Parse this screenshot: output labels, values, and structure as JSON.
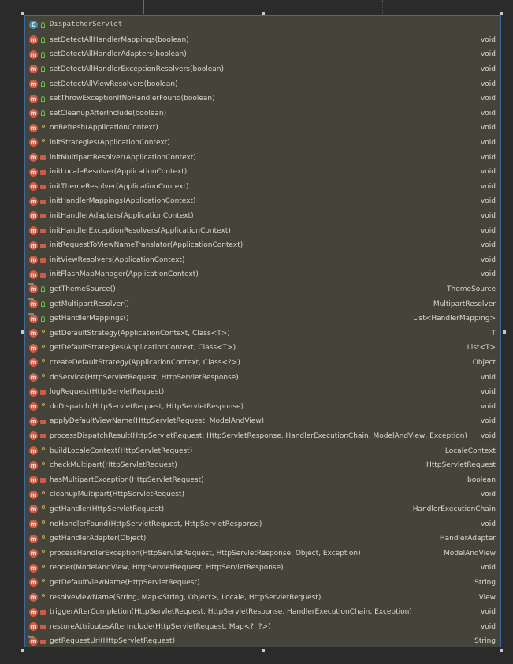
{
  "class_name": "DispatcherServlet",
  "methods": [
    {
      "name": "setDetectAllHandlerMappings(boolean)",
      "ret": "void",
      "vis": "public",
      "override": false
    },
    {
      "name": "setDetectAllHandlerAdapters(boolean)",
      "ret": "void",
      "vis": "public",
      "override": false
    },
    {
      "name": "setDetectAllHandlerExceptionResolvers(boolean)",
      "ret": "void",
      "vis": "public",
      "override": false
    },
    {
      "name": "setDetectAllViewResolvers(boolean)",
      "ret": "void",
      "vis": "public",
      "override": false
    },
    {
      "name": "setThrowExceptionIfNoHandlerFound(boolean)",
      "ret": "void",
      "vis": "public",
      "override": false
    },
    {
      "name": "setCleanupAfterInclude(boolean)",
      "ret": "void",
      "vis": "public",
      "override": false
    },
    {
      "name": "onRefresh(ApplicationContext)",
      "ret": "void",
      "vis": "protected",
      "override": false
    },
    {
      "name": "initStrategies(ApplicationContext)",
      "ret": "void",
      "vis": "protected",
      "override": false
    },
    {
      "name": "initMultipartResolver(ApplicationContext)",
      "ret": "void",
      "vis": "private",
      "override": false
    },
    {
      "name": "initLocaleResolver(ApplicationContext)",
      "ret": "void",
      "vis": "private",
      "override": false
    },
    {
      "name": "initThemeResolver(ApplicationContext)",
      "ret": "void",
      "vis": "private",
      "override": false
    },
    {
      "name": "initHandlerMappings(ApplicationContext)",
      "ret": "void",
      "vis": "private",
      "override": false
    },
    {
      "name": "initHandlerAdapters(ApplicationContext)",
      "ret": "void",
      "vis": "private",
      "override": false
    },
    {
      "name": "initHandlerExceptionResolvers(ApplicationContext)",
      "ret": "void",
      "vis": "private",
      "override": false
    },
    {
      "name": "initRequestToViewNameTranslator(ApplicationContext)",
      "ret": "void",
      "vis": "private",
      "override": false
    },
    {
      "name": "initViewResolvers(ApplicationContext)",
      "ret": "void",
      "vis": "private",
      "override": false
    },
    {
      "name": "initFlashMapManager(ApplicationContext)",
      "ret": "void",
      "vis": "private",
      "override": false
    },
    {
      "name": "getThemeSource()",
      "ret": "ThemeSource",
      "vis": "public",
      "override": true
    },
    {
      "name": "getMultipartResolver()",
      "ret": "MultipartResolver",
      "vis": "public",
      "override": true
    },
    {
      "name": "getHandlerMappings()",
      "ret": "List<HandlerMapping>",
      "vis": "public",
      "override": true
    },
    {
      "name": "getDefaultStrategy(ApplicationContext, Class<T>)",
      "ret": "T",
      "vis": "protected",
      "override": false
    },
    {
      "name": "getDefaultStrategies(ApplicationContext, Class<T>)",
      "ret": "List<T>",
      "vis": "protected",
      "override": false
    },
    {
      "name": "createDefaultStrategy(ApplicationContext, Class<?>)",
      "ret": "Object",
      "vis": "protected",
      "override": false
    },
    {
      "name": "doService(HttpServletRequest, HttpServletResponse)",
      "ret": "void",
      "vis": "protected",
      "override": false
    },
    {
      "name": "logRequest(HttpServletRequest)",
      "ret": "void",
      "vis": "private",
      "override": false
    },
    {
      "name": "doDispatch(HttpServletRequest, HttpServletResponse)",
      "ret": "void",
      "vis": "protected",
      "override": false
    },
    {
      "name": "applyDefaultViewName(HttpServletRequest, ModelAndView)",
      "ret": "void",
      "vis": "private",
      "override": false
    },
    {
      "name": "processDispatchResult(HttpServletRequest, HttpServletResponse, HandlerExecutionChain, ModelAndView, Exception)",
      "ret": "void",
      "vis": "private",
      "override": false
    },
    {
      "name": "buildLocaleContext(HttpServletRequest)",
      "ret": "LocaleContext",
      "vis": "protected",
      "override": false
    },
    {
      "name": "checkMultipart(HttpServletRequest)",
      "ret": "HttpServletRequest",
      "vis": "protected",
      "override": false
    },
    {
      "name": "hasMultipartException(HttpServletRequest)",
      "ret": "boolean",
      "vis": "private",
      "override": false
    },
    {
      "name": "cleanupMultipart(HttpServletRequest)",
      "ret": "void",
      "vis": "protected",
      "override": false
    },
    {
      "name": "getHandler(HttpServletRequest)",
      "ret": "HandlerExecutionChain",
      "vis": "protected",
      "override": false
    },
    {
      "name": "noHandlerFound(HttpServletRequest, HttpServletResponse)",
      "ret": "void",
      "vis": "protected",
      "override": false
    },
    {
      "name": "getHandlerAdapter(Object)",
      "ret": "HandlerAdapter",
      "vis": "protected",
      "override": false
    },
    {
      "name": "processHandlerException(HttpServletRequest, HttpServletResponse, Object, Exception)",
      "ret": "ModelAndView",
      "vis": "protected",
      "override": false
    },
    {
      "name": "render(ModelAndView, HttpServletRequest, HttpServletResponse)",
      "ret": "void",
      "vis": "protected",
      "override": false
    },
    {
      "name": "getDefaultViewName(HttpServletRequest)",
      "ret": "String",
      "vis": "protected",
      "override": false
    },
    {
      "name": "resolveViewName(String, Map<String, Object>, Locale, HttpServletRequest)",
      "ret": "View",
      "vis": "protected",
      "override": false
    },
    {
      "name": "triggerAfterCompletion(HttpServletRequest, HttpServletResponse, HandlerExecutionChain, Exception)",
      "ret": "void",
      "vis": "private",
      "override": false
    },
    {
      "name": "restoreAttributesAfterInclude(HttpServletRequest, Map<?, ?>)",
      "ret": "void",
      "vis": "private",
      "override": false
    },
    {
      "name": "getRequestUri(HttpServletRequest)",
      "ret": "String",
      "vis": "private",
      "override": true
    }
  ],
  "colors": {
    "panel_bg": "#45443a",
    "border": "#3d6aa3",
    "method_icon": "#cc5b48",
    "class_icon": "#3e8fb0",
    "public": "#6fbf3e",
    "protected": "#c9a94d",
    "private": "#d35a47"
  }
}
